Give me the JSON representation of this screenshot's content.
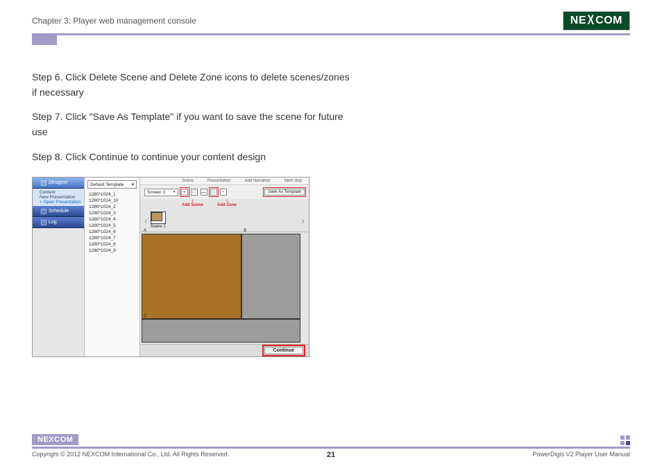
{
  "chapter_title": "Chapter 3: Player web management console",
  "brand": {
    "part1": "NE",
    "x": "X",
    "part2": "COM"
  },
  "steps": {
    "s6": "Step 6. Click Delete Scene and Delete Zone icons to delete scenes/zones if necessary",
    "s7": "Step 7. Click \"Save As Template\" if you want to save the scene for future use",
    "s8": "Step 8. Click Continue to continue your content design"
  },
  "ui": {
    "nav": {
      "designer": "Designer",
      "content": "Content",
      "new_presentation": "New Presentation",
      "open_presentation": "+ Open Presentation",
      "schedule": "Schedule",
      "log": "Log"
    },
    "template_selector": "Default Template",
    "resolutions": [
      "1280*1024_1",
      "1280*1024_10",
      "1280*1024_2",
      "1280*1024_3",
      "1280*1024_4",
      "1280*1024_5",
      "1280*1024_6",
      "1280*1024_7",
      "1280*1024_8",
      "1280*1024_9"
    ],
    "topmenu": [
      "Scene",
      "Presentation",
      "Add Narration",
      "Next step"
    ],
    "screen_selector": "Screen 1",
    "save_template": "Save As Template",
    "callouts": {
      "add_scene": "Add Scene",
      "add_zone": "Add Zone"
    },
    "scene_label": "Scene 1",
    "zones": {
      "a": "A",
      "b": "B",
      "c": "C"
    },
    "continue": "Continue"
  },
  "footer": {
    "copyright": "Copyright © 2012 NEXCOM International Co., Ltd. All Rights Reserved.",
    "page": "21",
    "manual": "PowerDigis V2 Player User Manual"
  }
}
